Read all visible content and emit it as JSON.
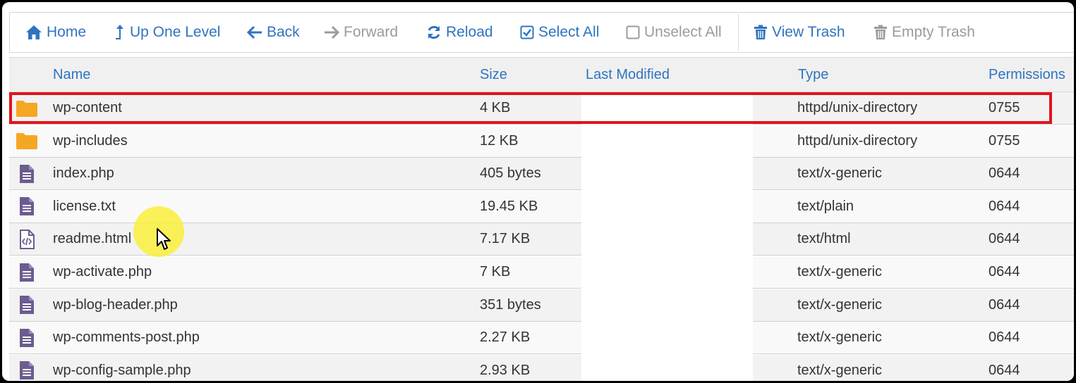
{
  "toolbar": {
    "home": "Home",
    "up_one_level": "Up One Level",
    "back": "Back",
    "forward": "Forward",
    "reload": "Reload",
    "select_all": "Select All",
    "unselect_all": "Unselect All",
    "view_trash": "View Trash",
    "empty_trash": "Empty Trash"
  },
  "columns": {
    "name": "Name",
    "size": "Size",
    "last_modified": "Last Modified",
    "type": "Type",
    "permissions": "Permissions"
  },
  "rows": [
    {
      "icon": "folder-icon",
      "name": "wp-content",
      "size": "4 KB",
      "type": "httpd/unix-directory",
      "perms": "0755"
    },
    {
      "icon": "folder-icon",
      "name": "wp-includes",
      "size": "12 KB",
      "type": "httpd/unix-directory",
      "perms": "0755"
    },
    {
      "icon": "file-icon",
      "name": "index.php",
      "size": "405 bytes",
      "type": "text/x-generic",
      "perms": "0644"
    },
    {
      "icon": "file-icon",
      "name": "license.txt",
      "size": "19.45 KB",
      "type": "text/plain",
      "perms": "0644"
    },
    {
      "icon": "html-file-icon",
      "name": "readme.html",
      "size": "7.17 KB",
      "type": "text/html",
      "perms": "0644"
    },
    {
      "icon": "file-icon",
      "name": "wp-activate.php",
      "size": "7 KB",
      "type": "text/x-generic",
      "perms": "0644"
    },
    {
      "icon": "file-icon",
      "name": "wp-blog-header.php",
      "size": "351 bytes",
      "type": "text/x-generic",
      "perms": "0644"
    },
    {
      "icon": "file-icon",
      "name": "wp-comments-post.php",
      "size": "2.27 KB",
      "type": "text/x-generic",
      "perms": "0644"
    },
    {
      "icon": "file-icon",
      "name": "wp-config-sample.php",
      "size": "2.93 KB",
      "type": "text/x-generic",
      "perms": "0644"
    }
  ],
  "colors": {
    "link": "#2f74c0",
    "disabled": "#9b9b9b",
    "folder": "#f5a623",
    "file": "#6c5c8f",
    "highlight": "#e0141c"
  }
}
